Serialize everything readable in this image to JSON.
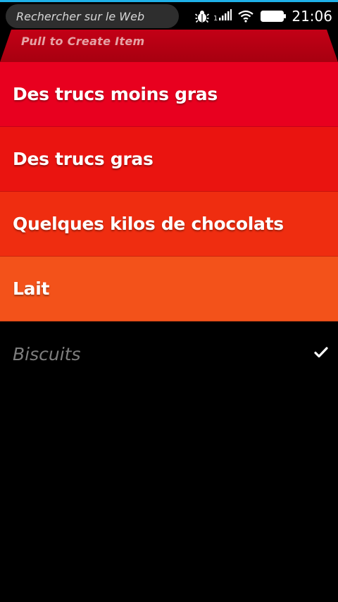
{
  "statusbar": {
    "search_placeholder": "Rechercher sur le Web",
    "signal_number": "1",
    "time": "21:06",
    "accent_color": "#1fb1e8",
    "icons": [
      "bug-icon",
      "signal-icon",
      "wifi-icon",
      "battery-icon"
    ]
  },
  "pull_header": {
    "label": "Pull to Create Item",
    "color": "#b20013"
  },
  "list": {
    "items": [
      {
        "label": "Des trucs moins gras",
        "color": "#e8001f",
        "done": false
      },
      {
        "label": "Des trucs gras",
        "color": "#ea1410",
        "done": false
      },
      {
        "label": "Quelques kilos de chocolats",
        "color": "#ef2d10",
        "done": false
      },
      {
        "label": "Lait",
        "color": "#f3521a",
        "done": false
      }
    ],
    "completed": [
      {
        "label": "Biscuits",
        "done": true,
        "icon": "checkmark-icon"
      }
    ]
  }
}
